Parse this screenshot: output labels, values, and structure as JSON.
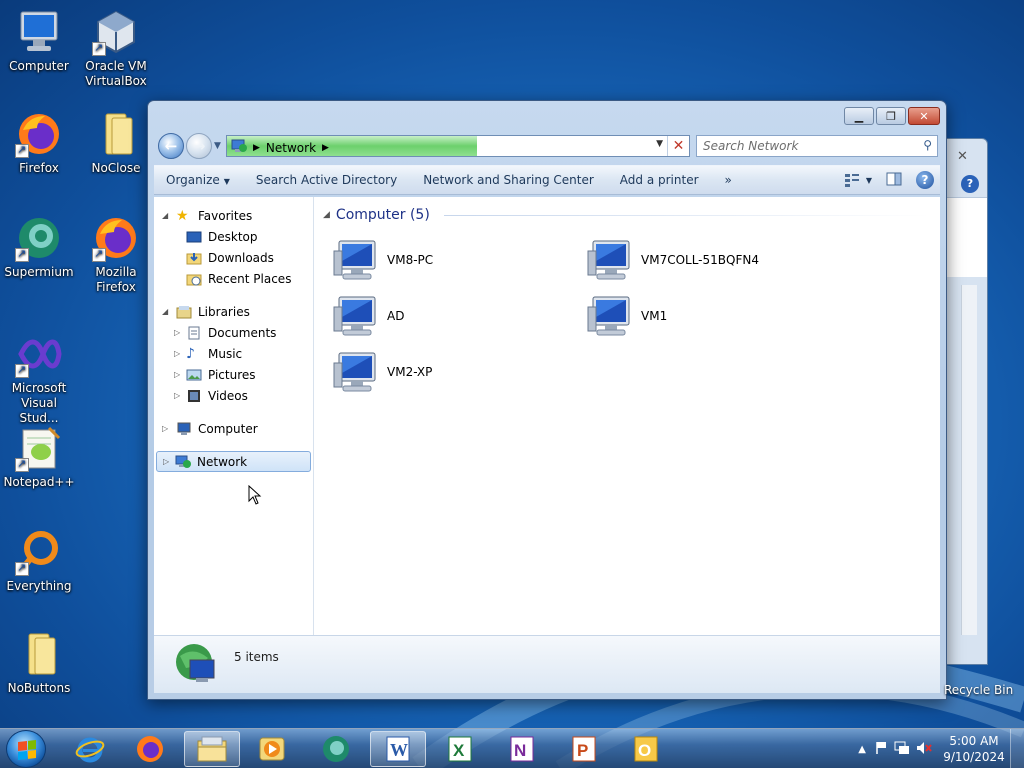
{
  "desktop": {
    "icons": [
      {
        "label": "Computer"
      },
      {
        "label": "Oracle VM\nVirtualBox"
      },
      {
        "label": "Firefox"
      },
      {
        "label": "NoClose"
      },
      {
        "label": "Supermium"
      },
      {
        "label": "Mozilla\nFirefox"
      },
      {
        "label": "Microsoft\nVisual Stud..."
      },
      {
        "label": "Notepad++"
      },
      {
        "label": "Everything"
      },
      {
        "label": "NoButtons"
      }
    ],
    "recycle_bin": "Recycle Bin"
  },
  "window": {
    "address": {
      "crumb": "Network"
    },
    "search": {
      "placeholder": "Search Network"
    },
    "toolbar": {
      "organize": "Organize",
      "search_ad": "Search Active Directory",
      "network_center": "Network and Sharing Center",
      "add_printer": "Add a printer",
      "more": "»"
    },
    "nav": {
      "favorites": "Favorites",
      "desktop": "Desktop",
      "downloads": "Downloads",
      "recent": "Recent Places",
      "libraries": "Libraries",
      "documents": "Documents",
      "music": "Music",
      "pictures": "Pictures",
      "videos": "Videos",
      "computer": "Computer",
      "network": "Network"
    },
    "group_header": "Computer (5)",
    "items": [
      "VM8-PC",
      "VM7COLL-51BQFN4",
      "AD",
      "VM1",
      "VM2-XP"
    ],
    "status": "5 items"
  },
  "taskbar": {
    "time": "5:00 AM",
    "date": "9/10/2024"
  },
  "colors": {
    "desktop_blue": "#1a6cc0",
    "address_progress": "#6cd06c",
    "group_header": "#1e3287"
  }
}
